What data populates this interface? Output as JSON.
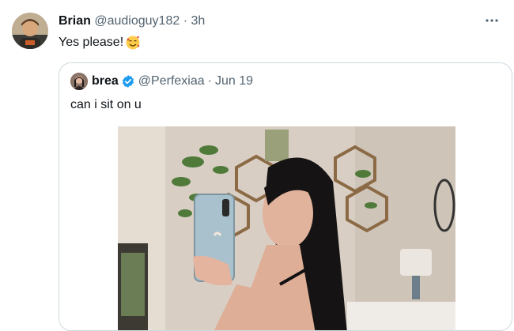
{
  "tweet": {
    "author_name": "Brian",
    "handle": "@audioguy182",
    "separator": "·",
    "time": "3h",
    "text": "Yes please!",
    "emoji_icon": "smiling-face-with-hearts-icon",
    "more_icon": "more-options-icon"
  },
  "quoted_tweet": {
    "author_name": "brea",
    "verified": true,
    "handle": "@Perfexiaa",
    "separator": "·",
    "date": "Jun 19",
    "text": "can i sit on u",
    "media_description_icon": "photo"
  },
  "colors": {
    "text_primary": "#0f1419",
    "text_secondary": "#536471",
    "verified_blue": "#1d9bf0",
    "border": "#cfd9de"
  }
}
